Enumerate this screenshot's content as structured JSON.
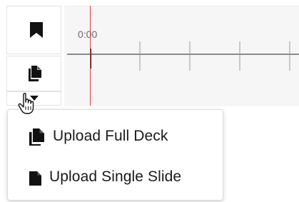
{
  "toolbar": {
    "buttons": [
      {
        "name": "bookmark",
        "icon": "bookmark-icon"
      },
      {
        "name": "slides",
        "icon": "document-copy-icon"
      },
      {
        "name": "dropdown",
        "icon": "caret-down-icon"
      }
    ]
  },
  "timeline": {
    "start_label": "0:00",
    "playhead_color": "#e43b3b"
  },
  "dropdown_menu": {
    "items": [
      {
        "label": "Upload Full Deck",
        "icon": "documents-icon"
      },
      {
        "label": "Upload Single Slide",
        "icon": "file-icon"
      }
    ]
  },
  "cursor": {
    "icon": "hand-pointer-icon"
  }
}
